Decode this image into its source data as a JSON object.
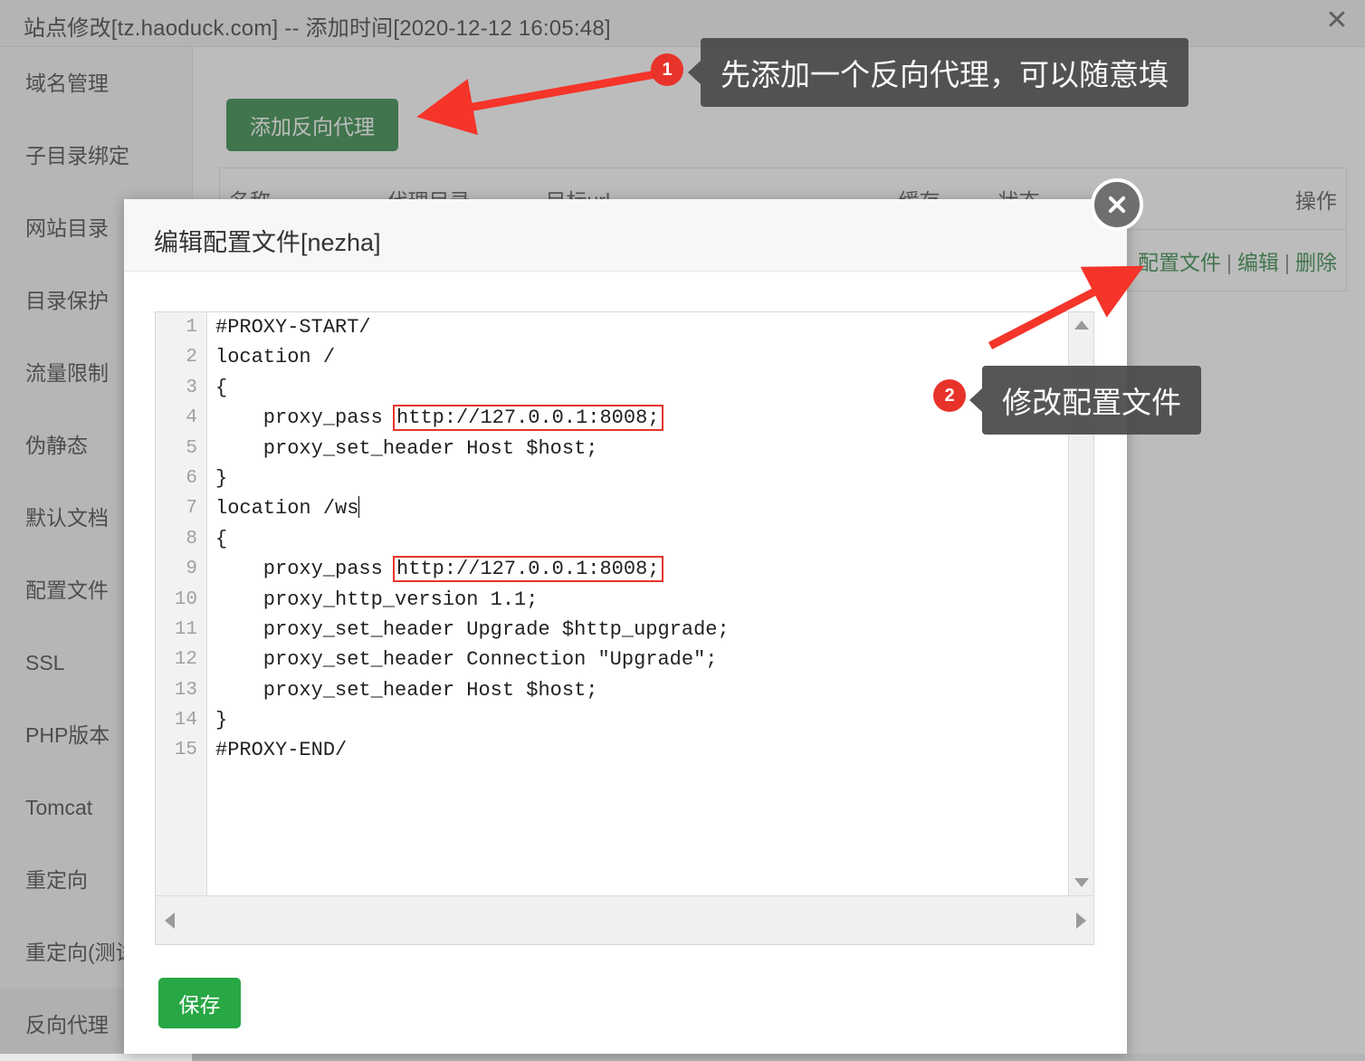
{
  "window": {
    "title": "站点修改[tz.haoduck.com] -- 添加时间[2020-12-12 16:05:48]",
    "close_glyph": "✕"
  },
  "sidebar": {
    "items": [
      {
        "label": "域名管理",
        "active": false
      },
      {
        "label": "子目录绑定",
        "active": false
      },
      {
        "label": "网站目录",
        "active": false
      },
      {
        "label": "目录保护",
        "active": false
      },
      {
        "label": "流量限制",
        "active": false
      },
      {
        "label": "伪静态",
        "active": false
      },
      {
        "label": "默认文档",
        "active": false
      },
      {
        "label": "配置文件",
        "active": false
      },
      {
        "label": "SSL",
        "active": false
      },
      {
        "label": "PHP版本",
        "active": false
      },
      {
        "label": "Tomcat",
        "active": false
      },
      {
        "label": "重定向",
        "active": false
      },
      {
        "label": "重定向(测试)",
        "active": false
      },
      {
        "label": "反向代理",
        "active": true
      }
    ]
  },
  "content": {
    "add_proxy_label": "添加反向代理",
    "table": {
      "headers": [
        "名称",
        "代理目录",
        "目标url",
        "缓存",
        "状态",
        "操作"
      ],
      "row_actions": [
        "配置文件",
        "编辑",
        "删除"
      ],
      "action_separator": "|"
    }
  },
  "modal": {
    "title": "编辑配置文件[nezha]",
    "save_label": "保存",
    "close_icon": "close-icon",
    "editor": {
      "line_numbers": [
        "1",
        "2",
        "3",
        "4",
        "5",
        "6",
        "7",
        "8",
        "9",
        "10",
        "11",
        "12",
        "13",
        "14",
        "15"
      ],
      "lines": [
        {
          "prefix": "#PROXY-START/",
          "highlight": "",
          "suffix": ""
        },
        {
          "prefix": "location /",
          "highlight": "",
          "suffix": ""
        },
        {
          "prefix": "{",
          "highlight": "",
          "suffix": ""
        },
        {
          "prefix": "    proxy_pass ",
          "highlight": "http://127.0.0.1:8008;",
          "suffix": ""
        },
        {
          "prefix": "    proxy_set_header Host $host;",
          "highlight": "",
          "suffix": ""
        },
        {
          "prefix": "}",
          "highlight": "",
          "suffix": ""
        },
        {
          "prefix": "location /ws",
          "highlight": "",
          "suffix": "",
          "caret": true
        },
        {
          "prefix": "{",
          "highlight": "",
          "suffix": ""
        },
        {
          "prefix": "    proxy_pass ",
          "highlight": "http://127.0.0.1:8008;",
          "suffix": ""
        },
        {
          "prefix": "    proxy_http_version 1.1;",
          "highlight": "",
          "suffix": ""
        },
        {
          "prefix": "    proxy_set_header Upgrade $http_upgrade;",
          "highlight": "",
          "suffix": ""
        },
        {
          "prefix": "    proxy_set_header Connection \"Upgrade\";",
          "highlight": "",
          "suffix": ""
        },
        {
          "prefix": "    proxy_set_header Host $host;",
          "highlight": "",
          "suffix": ""
        },
        {
          "prefix": "}",
          "highlight": "",
          "suffix": ""
        },
        {
          "prefix": "#PROXY-END/",
          "highlight": "",
          "suffix": ""
        }
      ]
    }
  },
  "annotations": [
    {
      "number": "1",
      "text": "先添加一个反向代理，可以随意填"
    },
    {
      "number": "2",
      "text": "修改配置文件"
    }
  ],
  "colors": {
    "brand_green": "#1d7d32",
    "save_green": "#28a745",
    "link_green": "#1d7d32",
    "annotation_red": "#e8332a",
    "annotation_box": "#4a4a4a"
  }
}
